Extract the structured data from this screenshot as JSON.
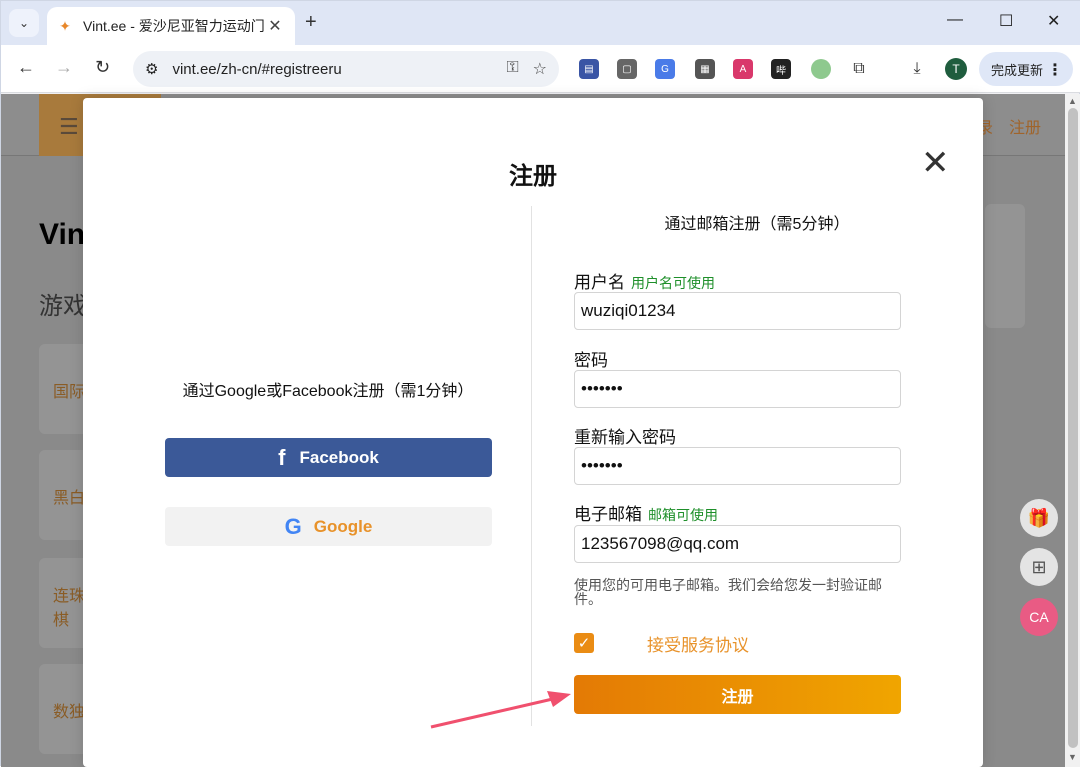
{
  "browser": {
    "tab_title": "Vint.ee - 爱沙尼亚智力运动门户",
    "url": "vint.ee/zh-cn/#registreeru",
    "update_label": "完成更新",
    "avatar_letter": "T"
  },
  "page_background": {
    "header_links": [
      "录",
      "注册"
    ],
    "title": "Vin",
    "subtitle": "游戏",
    "cards": [
      "国际",
      "黑白",
      "连珠\n棋",
      "数独"
    ]
  },
  "modal": {
    "title": "注册",
    "left": {
      "heading": "通过Google或Facebook注册（需1分钟）",
      "facebook_label": "Facebook",
      "google_label": "Google"
    },
    "right": {
      "heading": "通过邮箱注册（需5分钟）",
      "username_label": "用户名",
      "username_status": "用户名可使用",
      "username_value": "wuziqi01234",
      "password_label": "密码",
      "password_value": "•••••••",
      "password_repeat_label": "重新输入密码",
      "password_repeat_value": "•••••••",
      "email_label": "电子邮箱",
      "email_status": "邮箱可使用",
      "email_value": "123567098@qq.com",
      "email_hint": "使用您的可用电子邮箱。我们会给您发一封验证邮件。",
      "terms_label": "接受服务协议",
      "terms_checked": true,
      "submit_label": "注册"
    }
  },
  "colors": {
    "accent": "#ea8c14",
    "facebook": "#3b5998",
    "ok_green": "#1e8f2a",
    "annotation_arrow": "#f0506e"
  }
}
